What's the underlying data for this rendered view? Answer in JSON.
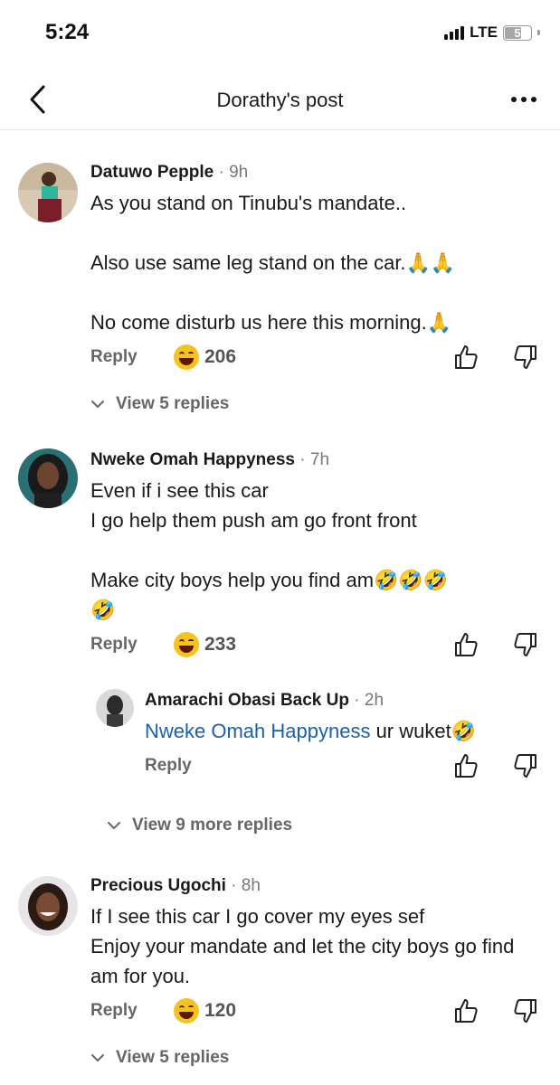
{
  "status_bar": {
    "time": "5:24",
    "network": "LTE",
    "battery": "5"
  },
  "header": {
    "title": "Dorathy's post"
  },
  "comments": [
    {
      "name": "Datuwo Pepple",
      "time": "· 9h",
      "text": "As you stand on Tinubu's mandate..\n\nAlso use same leg stand on the car.🙏🙏\n\nNo come disturb us here this morning.🙏",
      "reply_label": "Reply",
      "reactions": "206",
      "view_replies": "View 5 replies"
    },
    {
      "name": "Nweke Omah Happyness",
      "time": "· 7h",
      "text": "Even if i see this car\nI go help them push am go front front\n\nMake city boys help you find am🤣🤣🤣\n🤣",
      "reply_label": "Reply",
      "reactions": "233",
      "reply": {
        "name": "Amarachi Obasi Back Up",
        "time": "· 2h",
        "mention": "Nweke Omah Happyness",
        "text": " ur wuket🤣",
        "reply_label": "Reply"
      },
      "view_replies": "View 9 more replies"
    },
    {
      "name": "Precious Ugochi",
      "time": "· 8h",
      "text": "If I see this car I go cover my eyes sef\nEnjoy your mandate and let the city boys go find am for you.",
      "reply_label": "Reply",
      "reactions": "120",
      "view_replies": "View 5 replies"
    }
  ]
}
